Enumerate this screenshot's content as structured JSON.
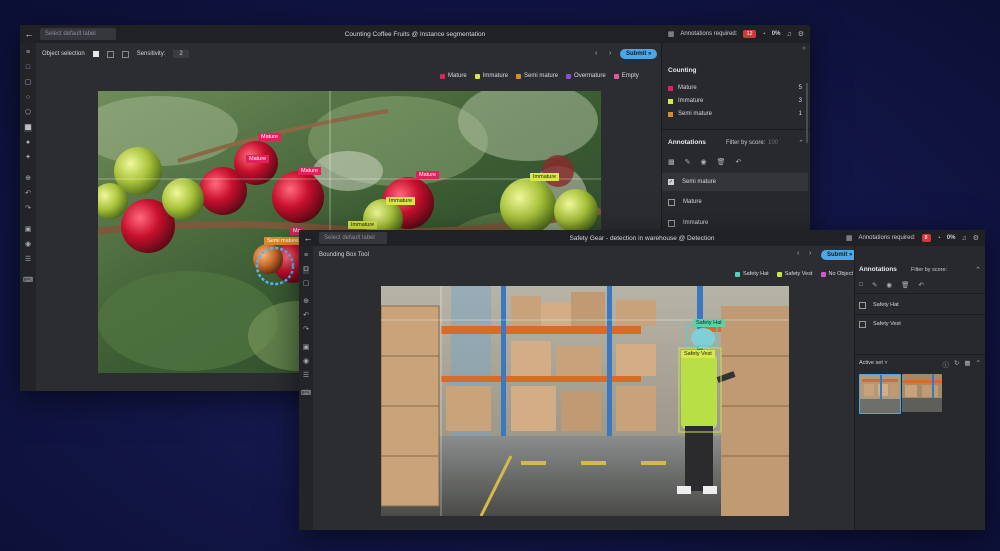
{
  "colors": {
    "mature": "#e0215c",
    "immature": "#d8e84a",
    "semi_mature": "#d88a2d",
    "overmature": "#8a4bd6",
    "empty": "#e05a9a",
    "safety_hat": "#4fd1c5",
    "safety_vest": "#c7e64a",
    "no_object": "#d05acb",
    "submit": "#4aa8e8",
    "badge": "#d4363a"
  },
  "w1": {
    "label_placeholder": "Select default label",
    "title": "Counting Coffee Fruits @ Instance segmentation",
    "annotations_required_label": "Annotations required:",
    "annotations_required_count": "12",
    "progress": "0%",
    "toolbar": {
      "object_selection": "Object selection",
      "sensitivity_label": "Sensitivity:",
      "sensitivity_value": "2",
      "submit": "Submit »"
    },
    "legend": [
      {
        "label": "Mature",
        "color": "#e0215c"
      },
      {
        "label": "Immature",
        "color": "#d8e84a"
      },
      {
        "label": "Semi mature",
        "color": "#d88a2d"
      },
      {
        "label": "Overmature",
        "color": "#8a4bd6"
      },
      {
        "label": "Empty",
        "color": "#e05a9a"
      }
    ],
    "counting": {
      "title": "Counting",
      "items": [
        {
          "label": "Mature",
          "count": "5",
          "color": "#e0215c"
        },
        {
          "label": "Immature",
          "count": "3",
          "color": "#d8e84a"
        },
        {
          "label": "Semi mature",
          "count": "1",
          "color": "#d88a2d"
        }
      ]
    },
    "annotations": {
      "title": "Annotations",
      "filter_label": "Filter by score:",
      "filter_value": "100",
      "items": [
        {
          "label": "Semi mature",
          "checked": true
        },
        {
          "label": "Mature",
          "checked": false
        },
        {
          "label": "Immature",
          "checked": false
        }
      ]
    },
    "tags": {
      "mature1": "Mature",
      "mature2": "Mature",
      "mature3": "Mature",
      "mature4": "Mature",
      "immature1": "Immature",
      "immature2": "Immature",
      "immature3": "Immature",
      "semi": "Semi mature",
      "mature5": "Ma"
    }
  },
  "w2": {
    "label_placeholder": "Select default label",
    "title": "Safety Gear - detection in warehouse @ Detection",
    "annotations_required_label": "Annotations required:",
    "annotations_required_count": "8",
    "progress": "0%",
    "tool_label": "Bounding Box Tool",
    "submit": "Submit »",
    "legend": [
      {
        "label": "Safety Hat",
        "color": "#4fd1c5"
      },
      {
        "label": "Safety Vest",
        "color": "#c7e64a"
      },
      {
        "label": "No Object",
        "color": "#d05acb"
      }
    ],
    "annotations": {
      "title": "Annotations",
      "filter_label": "Filter by score:",
      "items": [
        {
          "label": "Safety Hat"
        },
        {
          "label": "Safety Vest"
        }
      ]
    },
    "active_set_label": "Active set",
    "tags": {
      "hat": "Safety Hat",
      "vest": "Safety Vest"
    }
  }
}
